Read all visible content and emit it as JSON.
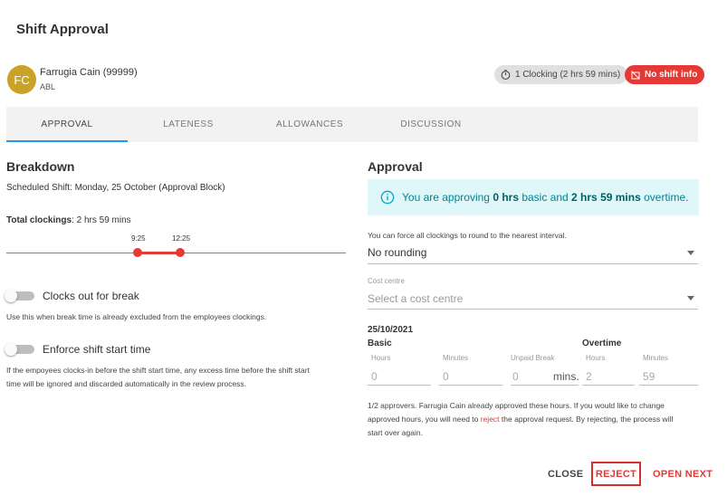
{
  "dialog": {
    "title": "Shift Approval"
  },
  "employee": {
    "initials": "FC",
    "name": "Farrugia Cain (99999)",
    "code": "ABL",
    "avatar_color": "#c9a227"
  },
  "chips": {
    "clocking": "1 Clocking (2 hrs 59 mins)",
    "no_shift": "No shift info"
  },
  "tabs": [
    {
      "label": "APPROVAL",
      "active": true
    },
    {
      "label": "LATENESS",
      "active": false
    },
    {
      "label": "ALLOWANCES",
      "active": false
    },
    {
      "label": "DISCUSSION",
      "active": false
    }
  ],
  "breakdown": {
    "heading": "Breakdown",
    "scheduled": "Scheduled Shift: Monday, 25 October (Approval Block)",
    "total_label": "Total clockings",
    "total_value": ": 2 hrs 59 mins",
    "timeline": {
      "start": "9:25",
      "end": "12:25"
    },
    "clocks_out_label": "Clocks out for break",
    "clocks_out_help": "Use this when break time is already excluded from the employees clockings.",
    "enforce_label": "Enforce shift start time",
    "enforce_help_1": "If the empoyees clocks-in before the shift start time, any excess time before the shift start",
    "enforce_help_2": "time will be ignored and discarded automatically in the review process."
  },
  "approval": {
    "heading": "Approval",
    "info_pre": "You are approving ",
    "info_basic": "0 hrs",
    "info_mid": " basic and ",
    "info_ot": "2 hrs 59 mins",
    "info_post": " overtime.",
    "rounding_hint": "You can force all clockings to round to the nearest interval.",
    "rounding_value": "No rounding",
    "cost_centre_label": "Cost centre",
    "cost_centre_placeholder": "Select a cost centre",
    "date": "25/10/2021",
    "basic_label": "Basic",
    "overtime_label": "Overtime",
    "hours_label": "Hours",
    "minutes_label": "Minutes",
    "unpaid_break_label": "Unpaid Break",
    "basic_hours": "0",
    "basic_minutes": "0",
    "unpaid_break": "0",
    "mins_suffix": "mins.",
    "ot_hours": "2",
    "ot_minutes": "59",
    "note_1": "1/2 approvers. Farrugia Cain already approved these hours. If you would like to change",
    "note_2a": "approved hours, you will need to ",
    "note_2_link": "reject",
    "note_2b": " the approval request. By rejecting, the process will",
    "note_3": "start over again."
  },
  "footer": {
    "close": "CLOSE",
    "reject": "REJECT",
    "open_next": "OPEN NEXT"
  },
  "colors": {
    "accent": "#2196f3",
    "danger": "#e53935",
    "info_bg": "#e0f7fa",
    "info_text": "#00838f"
  }
}
